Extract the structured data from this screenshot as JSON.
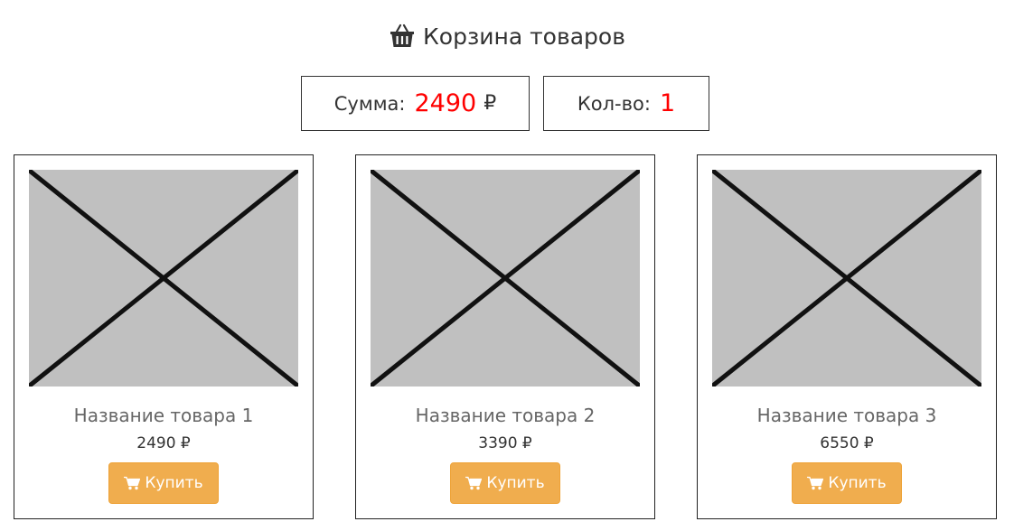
{
  "header": {
    "title": "Корзина товаров",
    "icon": "basket-icon"
  },
  "summary": {
    "sum_label": "Сумма:",
    "sum_value": "2490",
    "currency": "₽",
    "qty_label": "Кол-во:",
    "qty_value": "1",
    "value_color": "#ff0000"
  },
  "products": [
    {
      "name": "Название товара 1",
      "price": "2490 ₽",
      "buy_label": "Купить"
    },
    {
      "name": "Название товара 2",
      "price": "3390 ₽",
      "buy_label": "Купить"
    },
    {
      "name": "Название товара 3",
      "price": "6550 ₽",
      "buy_label": "Купить"
    }
  ],
  "colors": {
    "buy_button": "#f0ad4e",
    "image_placeholder": "#c0c0c0"
  }
}
